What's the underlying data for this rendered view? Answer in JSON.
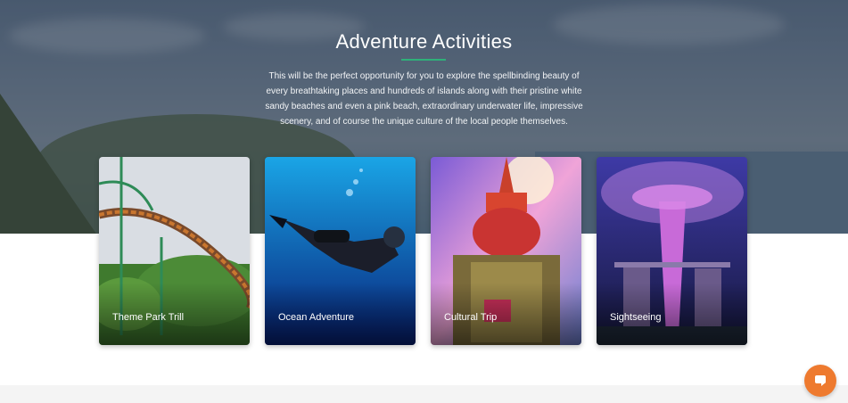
{
  "section": {
    "title": "Adventure Activities",
    "description": "This will be the perfect opportunity for you to explore the spellbinding beauty of every breathtaking places and hundreds of islands along with their pristine white sandy beaches and even a pink beach, extraordinary underwater life, impressive scenery, and of course the unique culture of the local people themselves."
  },
  "cards": [
    {
      "label": "Theme Park Trill"
    },
    {
      "label": "Ocean Adventure"
    },
    {
      "label": "Cultural Trip"
    },
    {
      "label": "Sightseeing"
    }
  ],
  "colors": {
    "accent": "#2fb07a",
    "chat_button": "#ee7a2f"
  },
  "chat": {
    "icon": "chat-bubble-icon"
  }
}
